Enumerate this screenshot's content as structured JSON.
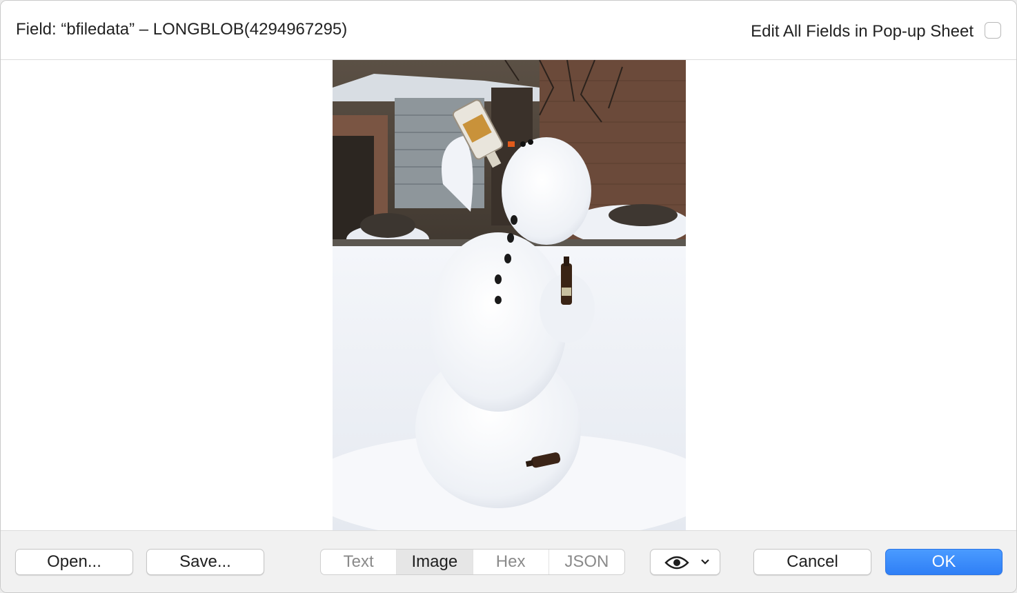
{
  "header": {
    "field_title": "Field: “bfiledata” – LONGBLOB(4294967295)",
    "popup_label": "Edit All Fields in Pop-up Sheet",
    "popup_checked": false
  },
  "viewer": {
    "image_subject": "snowman-drinking-from-bottle-photo"
  },
  "footer": {
    "open_label": "Open...",
    "save_label": "Save...",
    "modes": [
      "Text",
      "Image",
      "Hex",
      "JSON"
    ],
    "active_mode": "Image",
    "view_menu_icon": "eye-icon",
    "cancel_label": "Cancel",
    "ok_label": "OK"
  },
  "colors": {
    "accent": "#2f7ff6",
    "footer_bg": "#f1f1f1"
  }
}
